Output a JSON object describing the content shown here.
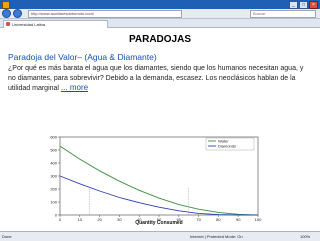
{
  "browser": {
    "url": "http://www.auxiliaresdotomoto.com/",
    "search_placeholder": "Buscar",
    "tab_title": "Universidad Latina",
    "status_left": "Done",
    "status_mid": "Internet | Protected Mode: On",
    "zoom": "100%"
  },
  "slide": {
    "title": "PARADOJAS",
    "subtitle": "Paradoja del Valor– (Agua & Diamante)",
    "body": "¿Por qué es más barata el agua que los diamantes, siendo que los humanos necesitan agua, y no diamantes, para sobrevivir? Debido a la demanda, escasez.  Los neoclásicos hablan de la utilidad marginal",
    "more_link": "... more"
  },
  "chart_data": {
    "type": "line",
    "xlabel": "Quantity Consumed",
    "ylabel": "Marginal Utility (utils)",
    "xlim": [
      0,
      100
    ],
    "ylim": [
      0,
      600
    ],
    "xticks": [
      0,
      10,
      20,
      30,
      40,
      50,
      60,
      70,
      80,
      90,
      100
    ],
    "yticks": [
      0,
      100,
      200,
      300,
      400,
      500,
      600
    ],
    "legend_position": "top-right",
    "series": [
      {
        "name": "Water",
        "color": "#3a8f3a",
        "x": [
          0,
          10,
          20,
          30,
          40,
          50,
          60,
          70,
          80,
          90,
          100
        ],
        "y": [
          530,
          430,
          340,
          260,
          190,
          130,
          80,
          45,
          20,
          5,
          0
        ]
      },
      {
        "name": "Diamonds",
        "color": "#2b3fb0",
        "x": [
          0,
          10,
          20,
          30,
          40,
          50,
          60,
          70,
          80,
          90,
          100
        ],
        "y": [
          300,
          240,
          185,
          135,
          95,
          60,
          32,
          12,
          3,
          0,
          0
        ]
      }
    ],
    "annotation_points": [
      {
        "series": "Water",
        "x": 15
      },
      {
        "series": "Diamonds",
        "x": 65
      }
    ]
  }
}
